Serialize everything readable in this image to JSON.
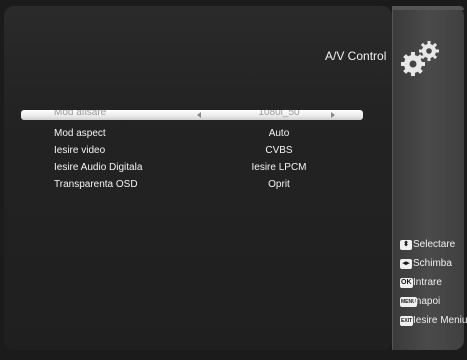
{
  "screen": {
    "title": "A/V Control"
  },
  "menu": {
    "items": [
      {
        "label": "Mod afisare",
        "value": "1080i_50",
        "selected": true
      },
      {
        "label": "Mod aspect",
        "value": "Auto",
        "selected": false
      },
      {
        "label": "Iesire video",
        "value": "CVBS",
        "selected": false
      },
      {
        "label": "Iesire Audio Digitala",
        "value": "Iesire LPCM",
        "selected": false
      },
      {
        "label": "Transparenta OSD",
        "value": "Oprit",
        "selected": false
      }
    ]
  },
  "legend": {
    "items": [
      {
        "key": "⬍",
        "label": "Selectare",
        "icon": "up-down-key-icon"
      },
      {
        "key": "◂▸",
        "label": "Schimba",
        "icon": "left-right-key-icon"
      },
      {
        "key": "OK",
        "label": "Intrare",
        "icon": "ok-key-icon"
      },
      {
        "key": "MENU",
        "label": "Inapoi",
        "icon": "menu-key-icon"
      },
      {
        "key": "EXIT",
        "label": "Iesire Meniu",
        "icon": "exit-key-icon"
      }
    ]
  },
  "colors": {
    "background": "#1b1b1b",
    "panel": "#232323",
    "side_panel": "#444444",
    "highlight": "#eaeaea",
    "text": "#f0f0f0"
  },
  "icons": {
    "header": "gears-icon"
  }
}
